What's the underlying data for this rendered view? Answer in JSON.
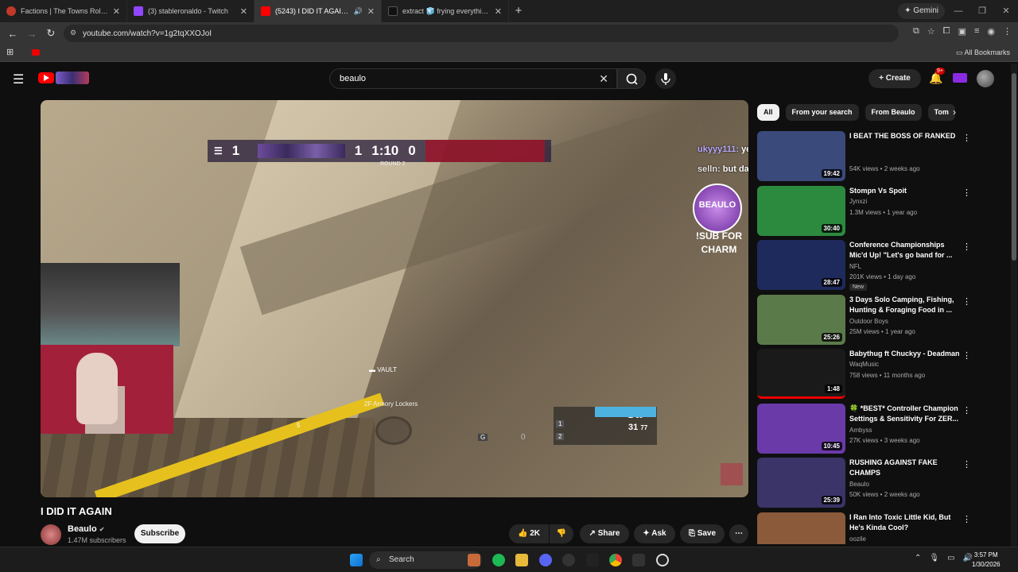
{
  "browser": {
    "tabs": [
      {
        "title": "Factions | The Towns Roleplay",
        "fav_color": "#c0392b",
        "active": false
      },
      {
        "title": "(3) stableronaldo - Twitch",
        "fav_color": "#9146ff",
        "active": false
      },
      {
        "title": "(5243) I DID IT AGAIN - You",
        "fav_color": "#ff0000",
        "active": true
      },
      {
        "title": "extract 🧊 frying everything an",
        "fav_color": "#111111",
        "active": false
      }
    ],
    "gemini_label": "Gemini",
    "url": "youtube.com/watch?v=1g2tqXXOJoI",
    "all_bookmarks": "All Bookmarks"
  },
  "youtube": {
    "search_value": "beaulo",
    "create_label": "Create",
    "notif_count": "9+"
  },
  "video": {
    "title": "I DID IT AGAIN",
    "channel": "Beaulo",
    "subscribers": "1.47M subscribers",
    "subscribe_label": "Subscribe",
    "likes": "2K",
    "share_label": "Share",
    "ask_label": "Ask",
    "save_label": "Save"
  },
  "game_hud": {
    "score_left": "1",
    "score_mid": "1",
    "timer": "1:10",
    "score_right": "0",
    "round": "ROUND 2",
    "vault": "VAULT",
    "location": "2F Armory Lockers",
    "ammo_primary": "2",
    "ammo_primary_reserve": "56",
    "ammo_secondary": "31",
    "ammo_secondary_reserve": "77",
    "gadget_a": "5",
    "gadget_b": "0",
    "slot_1": "1",
    "slot_2": "2",
    "key_g": "G",
    "chat": [
      {
        "user": "ukyyy111:",
        "msg": "yea but the Seahawks bot rn"
      },
      {
        "user": "selln:",
        "msg": "but darnold been outperforming maye"
      }
    ],
    "logo_text": "BEAULO",
    "sub_charm": "!SUB FOR CHARM"
  },
  "filters": {
    "chips": [
      "All",
      "From your search",
      "From Beaulo",
      "Tom"
    ]
  },
  "recommendations": [
    {
      "title": "I BEAT THE BOSS OF RANKED",
      "channel": "",
      "meta": "54K views • 2 weeks ago",
      "duration": "19:42",
      "thumb": "#3a4a7a",
      "new": ""
    },
    {
      "title": "Stompn Vs Spoit",
      "channel": "Jynxzi",
      "meta": "1.3M views • 1 year ago",
      "duration": "30:40",
      "thumb": "#2c8a3e",
      "new": ""
    },
    {
      "title": "Conference Championships Mic'd Up! \"Let's go band for ...",
      "channel": "NFL",
      "meta": "201K views • 1 day ago",
      "duration": "28:47",
      "thumb": "#1e2a5c",
      "new": "New"
    },
    {
      "title": "3 Days Solo Camping, Fishing, Hunting & Foraging Food in ...",
      "channel": "Outdoor Boys",
      "meta": "25M views • 1 year ago",
      "duration": "25:26",
      "thumb": "#5b7a4a",
      "new": ""
    },
    {
      "title": "Babythug ft Chuckyy - Deadman",
      "channel": "WaqMusic",
      "meta": "758 views • 11 months ago",
      "duration": "1:48",
      "thumb": "#1a1a1a",
      "new": ""
    },
    {
      "title": "🍀 *BEST* Controller Champion Settings & Sensitivity For ZER...",
      "channel": "Ambyss",
      "meta": "27K views • 3 weeks ago",
      "duration": "10:45",
      "thumb": "#6a3aa8",
      "new": ""
    },
    {
      "title": "RUSHING AGAINST FAKE CHAMPS",
      "channel": "Beaulo",
      "meta": "50K views • 2 weeks ago",
      "duration": "25:39",
      "thumb": "#3a3468",
      "new": ""
    },
    {
      "title": "I Ran Into Toxic Little Kid, But He's Kinda Cool?",
      "channel": "oozile",
      "meta": "",
      "duration": "",
      "thumb": "#8a5a3a",
      "new": ""
    }
  ],
  "taskbar": {
    "search_label": "Search",
    "time": "3:57 PM",
    "date": "1/30/2026"
  }
}
